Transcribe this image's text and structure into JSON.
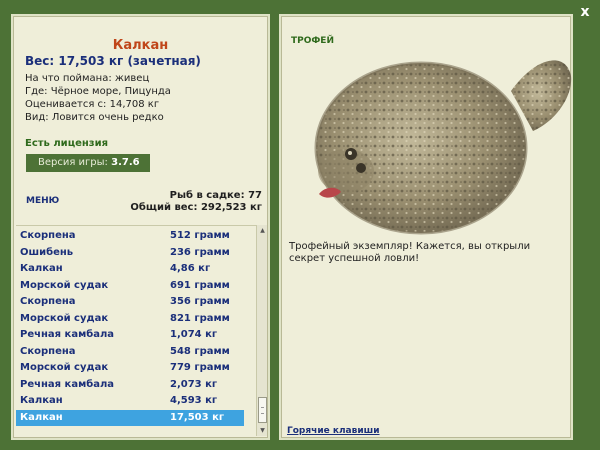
{
  "window": {
    "close_label": "x"
  },
  "fish": {
    "title": "Калкан",
    "weight_line": "Вес: 17,503 кг (зачетная)",
    "bait_line": "На что поймана: живец",
    "place_line": "Где: Чёрное море, Пицунда",
    "value_line": "Оценивается с: 14,708 кг",
    "kind_line": "Вид: Ловится очень редко"
  },
  "license": "Есть лицензия",
  "version": {
    "label": "Версия игры:",
    "value": "3.7.6"
  },
  "menu_label": "МЕНЮ",
  "cage": {
    "fish_count": "Рыб в садке: 77",
    "total_weight": "Общий вес: 292,523 кг"
  },
  "catch_list": [
    {
      "name": "Скорпена",
      "weight": "512 грамм"
    },
    {
      "name": "Ошибень",
      "weight": "236 грамм"
    },
    {
      "name": "Калкан",
      "weight": "4,86 кг"
    },
    {
      "name": "Морской судак",
      "weight": "691 грамм"
    },
    {
      "name": "Скорпена",
      "weight": "356 грамм"
    },
    {
      "name": "Морской судак",
      "weight": "821 грамм"
    },
    {
      "name": "Речная камбала",
      "weight": "1,074 кг"
    },
    {
      "name": "Скорпена",
      "weight": "548 грамм"
    },
    {
      "name": "Морской судак",
      "weight": "779 грамм"
    },
    {
      "name": "Речная камбала",
      "weight": "2,073 кг"
    },
    {
      "name": "Калкан",
      "weight": "4,593 кг"
    },
    {
      "name": "Калкан",
      "weight": "17,503 кг"
    }
  ],
  "selected_index": 11,
  "trophy": {
    "label": "ТРОФЕЙ",
    "text": "Трофейный экземпляр! Кажется, вы открыли секрет успешной ловли!"
  },
  "hotkeys_label": "Горячие клавиши",
  "colors": {
    "background": "#4d7236",
    "panel": "#efeed9",
    "title": "#c0461a",
    "text_blue": "#1b2f7a",
    "selection": "#3ea3e0"
  },
  "icons": {
    "close": "close-icon",
    "fish_image": "turbot-fish-icon"
  }
}
